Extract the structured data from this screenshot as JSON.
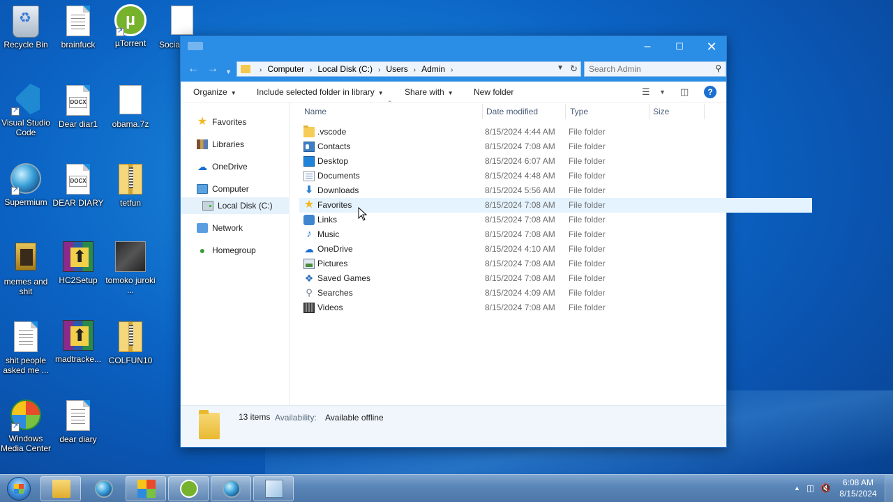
{
  "desktop": {
    "icons": [
      {
        "label": "Recycle Bin"
      },
      {
        "label": "brainfuck"
      },
      {
        "label": "µTorrent"
      },
      {
        "label": "Socia"
      },
      {
        "label": "Visual Studio Code"
      },
      {
        "label": "Dear diar1"
      },
      {
        "label": "obama.7z"
      },
      {
        "label": "Supermium"
      },
      {
        "label": "DEAR DIARY"
      },
      {
        "label": "tetfun"
      },
      {
        "label": "memes and shit"
      },
      {
        "label": "HC2Setup"
      },
      {
        "label": "tomoko juroki ..."
      },
      {
        "label": "shit people asked me ..."
      },
      {
        "label": "madtracke..."
      },
      {
        "label": "COLFUN10"
      },
      {
        "label": "Windows Media Center"
      },
      {
        "label": "dear diary"
      }
    ],
    "docx_tag": "DOCX"
  },
  "window": {
    "address": {
      "crumbs": [
        "Computer",
        "Local Disk (C:)",
        "Users",
        "Admin"
      ],
      "separator": "›"
    },
    "search": {
      "placeholder": "Search Admin"
    },
    "toolbar": {
      "organize": "Organize",
      "include": "Include selected folder in library",
      "share": "Share with",
      "new_folder": "New folder"
    },
    "nav": {
      "favorites": "Favorites",
      "libraries": "Libraries",
      "onedrive": "OneDrive",
      "computer": "Computer",
      "local_disk": "Local Disk (C:)",
      "network": "Network",
      "homegroup": "Homegroup"
    },
    "columns": {
      "name": "Name",
      "date": "Date modified",
      "type": "Type",
      "size": "Size"
    },
    "files": [
      {
        "name": ".vscode",
        "date": "8/15/2024 4:44 AM",
        "type": "File folder",
        "icon": "folder-icon"
      },
      {
        "name": "Contacts",
        "date": "8/15/2024 7:08 AM",
        "type": "File folder",
        "icon": "contacts-icon"
      },
      {
        "name": "Desktop",
        "date": "8/15/2024 6:07 AM",
        "type": "File folder",
        "icon": "desktop-icon"
      },
      {
        "name": "Documents",
        "date": "8/15/2024 4:48 AM",
        "type": "File folder",
        "icon": "documents-icon"
      },
      {
        "name": "Downloads",
        "date": "8/15/2024 5:56 AM",
        "type": "File folder",
        "icon": "downloads-icon"
      },
      {
        "name": "Favorites",
        "date": "8/15/2024 7:08 AM",
        "type": "File folder",
        "icon": "favorites-icon"
      },
      {
        "name": "Links",
        "date": "8/15/2024 7:08 AM",
        "type": "File folder",
        "icon": "links-icon"
      },
      {
        "name": "Music",
        "date": "8/15/2024 7:08 AM",
        "type": "File folder",
        "icon": "music-icon"
      },
      {
        "name": "OneDrive",
        "date": "8/15/2024 4:10 AM",
        "type": "File folder",
        "icon": "onedrive-icon"
      },
      {
        "name": "Pictures",
        "date": "8/15/2024 7:08 AM",
        "type": "File folder",
        "icon": "pictures-icon"
      },
      {
        "name": "Saved Games",
        "date": "8/15/2024 7:08 AM",
        "type": "File folder",
        "icon": "saved-games-icon"
      },
      {
        "name": "Searches",
        "date": "8/15/2024 4:09 AM",
        "type": "File folder",
        "icon": "searches-icon"
      },
      {
        "name": "Videos",
        "date": "8/15/2024 7:08 AM",
        "type": "File folder",
        "icon": "videos-icon"
      }
    ],
    "details": {
      "count": "13 items",
      "availability_label": "Availability:",
      "availability_value": "Available offline"
    }
  },
  "taskbar": {
    "clock_time": "6:08 AM",
    "clock_date": "8/15/2024"
  },
  "colors": {
    "title_bar": "#2b8ee6",
    "selection": "#e5f1fb",
    "hover_row": "#e5f3ff"
  }
}
